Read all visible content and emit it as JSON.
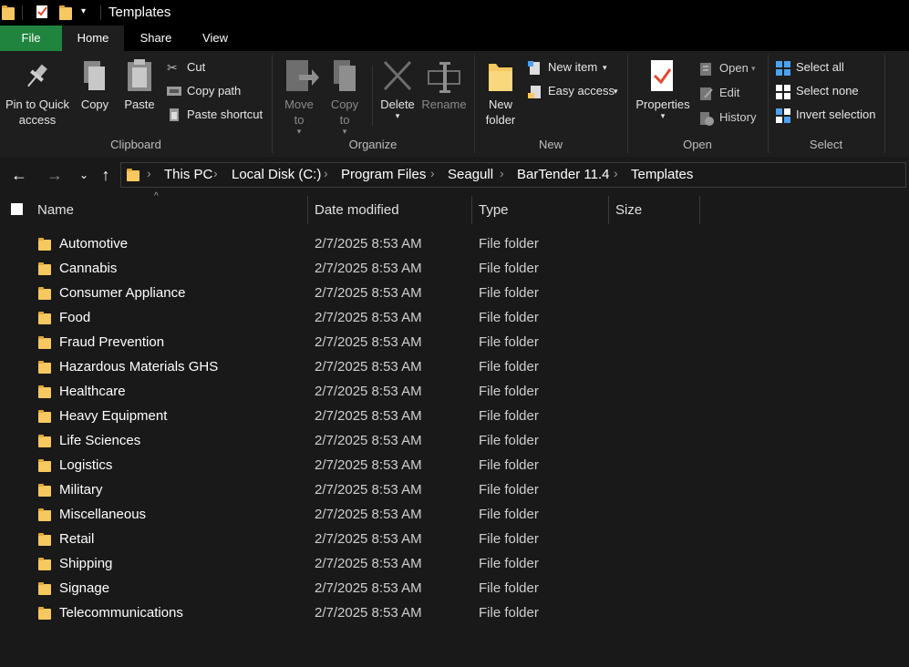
{
  "window": {
    "title": "Templates"
  },
  "tabs": [
    {
      "label": "File"
    },
    {
      "label": "Home"
    },
    {
      "label": "Share"
    },
    {
      "label": "View"
    }
  ],
  "ribbon": {
    "clipboard": {
      "pin_label": "Pin to Quick access",
      "copy_label": "Copy",
      "paste_label": "Paste",
      "cut_label": "Cut",
      "copy_path_label": "Copy path",
      "paste_shortcut_label": "Paste shortcut",
      "group_label": "Clipboard"
    },
    "organize": {
      "move_to_label": "Move to",
      "copy_to_label": "Copy to",
      "delete_label": "Delete",
      "rename_label": "Rename",
      "group_label": "Organize"
    },
    "new": {
      "new_folder_label": "New folder",
      "new_item_label": "New item",
      "easy_access_label": "Easy access",
      "group_label": "New"
    },
    "open": {
      "properties_label": "Properties",
      "open_label": "Open",
      "edit_label": "Edit",
      "history_label": "History",
      "group_label": "Open"
    },
    "select": {
      "select_all_label": "Select all",
      "select_none_label": "Select none",
      "invert_selection_label": "Invert selection",
      "group_label": "Select"
    }
  },
  "breadcrumbs": [
    "This PC",
    "Local Disk (C:)",
    "Program Files",
    "Seagull",
    "BarTender 11.4",
    "Templates"
  ],
  "columns": {
    "name": "Name",
    "date": "Date modified",
    "type": "Type",
    "size": "Size"
  },
  "files": [
    {
      "name": "Automotive",
      "date": "2/7/2025 8:53 AM",
      "type": "File folder"
    },
    {
      "name": "Cannabis",
      "date": "2/7/2025 8:53 AM",
      "type": "File folder"
    },
    {
      "name": "Consumer Appliance",
      "date": "2/7/2025 8:53 AM",
      "type": "File folder"
    },
    {
      "name": "Food",
      "date": "2/7/2025 8:53 AM",
      "type": "File folder"
    },
    {
      "name": "Fraud Prevention",
      "date": "2/7/2025 8:53 AM",
      "type": "File folder"
    },
    {
      "name": "Hazardous Materials GHS",
      "date": "2/7/2025 8:53 AM",
      "type": "File folder"
    },
    {
      "name": "Healthcare",
      "date": "2/7/2025 8:53 AM",
      "type": "File folder"
    },
    {
      "name": "Heavy Equipment",
      "date": "2/7/2025 8:53 AM",
      "type": "File folder"
    },
    {
      "name": "Life Sciences",
      "date": "2/7/2025 8:53 AM",
      "type": "File folder"
    },
    {
      "name": "Logistics",
      "date": "2/7/2025 8:53 AM",
      "type": "File folder"
    },
    {
      "name": "Military",
      "date": "2/7/2025 8:53 AM",
      "type": "File folder"
    },
    {
      "name": "Miscellaneous",
      "date": "2/7/2025 8:53 AM",
      "type": "File folder"
    },
    {
      "name": "Retail",
      "date": "2/7/2025 8:53 AM",
      "type": "File folder"
    },
    {
      "name": "Shipping",
      "date": "2/7/2025 8:53 AM",
      "type": "File folder"
    },
    {
      "name": "Signage",
      "date": "2/7/2025 8:53 AM",
      "type": "File folder"
    },
    {
      "name": "Telecommunications",
      "date": "2/7/2025 8:53 AM",
      "type": "File folder"
    }
  ],
  "colors": {
    "file_tab": "#20843f",
    "folder": "#f6c85f",
    "background": "#191919"
  }
}
